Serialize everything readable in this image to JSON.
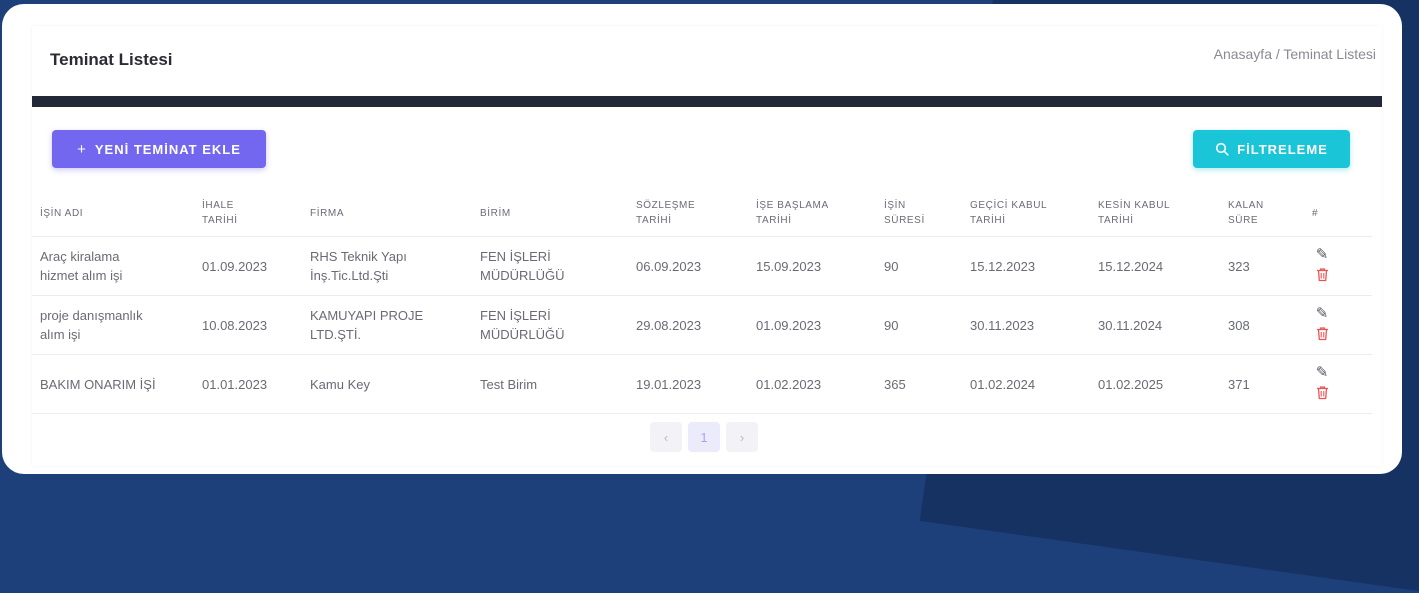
{
  "header": {
    "title": "Teminat Listesi",
    "breadcrumb": "Anasayfa / Teminat Listesi"
  },
  "toolbar": {
    "add_icon": "+",
    "add_label": "YENİ TEMİNAT EKLE",
    "filter_icon": "search-icon",
    "filter_label": "FİLTRELEME"
  },
  "colors": {
    "primary": "#7367f0",
    "info": "#1bc5d8",
    "danger": "#ea5455",
    "dark_bar": "#222838"
  },
  "table": {
    "columns": [
      [
        "İŞİN ADI"
      ],
      [
        "İHALE",
        "TARİHİ"
      ],
      [
        "FİRMA"
      ],
      [
        "BİRİM"
      ],
      [
        "SÖZLEŞME",
        "TARİHİ"
      ],
      [
        "İŞE BAŞLAMA",
        "TARİHİ"
      ],
      [
        "İŞİN",
        "SÜRESİ"
      ],
      [
        "GEÇİCİ KABUL",
        "TARİHİ"
      ],
      [
        "KESİN KABUL",
        "TARİHİ"
      ],
      [
        "KALAN",
        "SÜRE"
      ],
      [
        "#"
      ]
    ],
    "rows": [
      [
        [
          "Araç kiralama",
          "hizmet alım işi"
        ],
        [
          "01.09.2023"
        ],
        [
          "RHS Teknik Yapı",
          "İnş.Tic.Ltd.Şti"
        ],
        [
          "FEN İŞLERİ",
          "MÜDÜRLÜĞÜ"
        ],
        [
          "06.09.2023"
        ],
        [
          "15.09.2023"
        ],
        [
          "90"
        ],
        [
          "15.12.2023"
        ],
        [
          "15.12.2024"
        ],
        [
          "323"
        ]
      ],
      [
        [
          "proje danışmanlık",
          "alım işi"
        ],
        [
          "10.08.2023"
        ],
        [
          "KAMUYAPI PROJE",
          "LTD.ŞTİ."
        ],
        [
          "FEN İŞLERİ",
          "MÜDÜRLÜĞÜ"
        ],
        [
          "29.08.2023"
        ],
        [
          "01.09.2023"
        ],
        [
          "90"
        ],
        [
          "30.11.2023"
        ],
        [
          "30.11.2024"
        ],
        [
          "308"
        ]
      ],
      [
        [
          "BAKIM ONARIM İŞİ"
        ],
        [
          "01.01.2023"
        ],
        [
          "Kamu Key"
        ],
        [
          "Test Birim"
        ],
        [
          "19.01.2023"
        ],
        [
          "01.02.2023"
        ],
        [
          "365"
        ],
        [
          "01.02.2024"
        ],
        [
          "01.02.2025"
        ],
        [
          "371"
        ]
      ]
    ],
    "row_actions": [
      "edit-icon",
      "trash-icon"
    ]
  },
  "pagination": {
    "prev": "‹",
    "current": "1",
    "next": "›"
  }
}
